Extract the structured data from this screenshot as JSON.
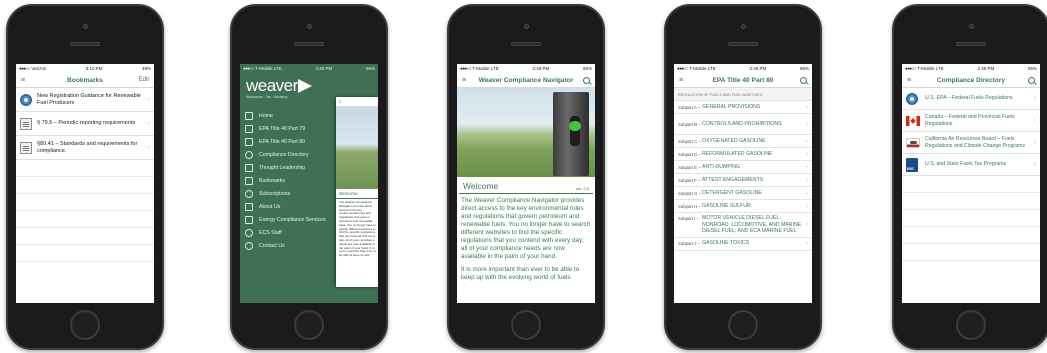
{
  "colors": {
    "accent": "#3c7a55",
    "menu_bg": "#3f6f55",
    "chevron": "#bdbdbd"
  },
  "phone1": {
    "status": {
      "carrier": "Verizon",
      "time": "3:10 PM",
      "battery": "49%"
    },
    "title": "Bookmarks",
    "edit_label": "Edit",
    "items": [
      {
        "icon": "epa-seal-icon",
        "text": "New Registration Guidance for Renewable Fuel Producers"
      },
      {
        "icon": "document-icon",
        "text": "§ 79.5 – Periodic reporting requirements"
      },
      {
        "icon": "document-icon",
        "text": "§80.41 – Standards and requirements for compliance."
      }
    ]
  },
  "phone2": {
    "status": {
      "carrier": "T-Mobile",
      "network": "LTE",
      "time": "2:46 PM",
      "battery": "66%"
    },
    "logo": {
      "word": "weaver",
      "tagline": "Assurance · Tax · Advisory"
    },
    "menu": [
      {
        "icon": "home-icon",
        "label": "Home"
      },
      {
        "icon": "book-icon",
        "label": "EPA Title 40 Part 79"
      },
      {
        "icon": "book-icon",
        "label": "EPA Title 40 Part 80"
      },
      {
        "icon": "link-icon",
        "label": "Compliance Directory"
      },
      {
        "icon": "document-icon",
        "label": "Thought Leadership"
      },
      {
        "icon": "bookmark-icon",
        "label": "Bookmarks"
      },
      {
        "icon": "rss-icon",
        "label": "Subscriptions"
      },
      {
        "icon": "arrow-icon",
        "label": "About Us"
      },
      {
        "icon": "building-icon",
        "label": "Energy Compliance Services"
      },
      {
        "icon": "people-icon",
        "label": "ECS Staff"
      },
      {
        "icon": "phone-icon",
        "label": "Contact Us"
      }
    ],
    "peek": {
      "title": "Welcome",
      "text": "The Weaver Compliance Navigator provides direct access to the key environmental rules and regulations that govern petroleum and renewable fuels. You no longer have to search different websites to find the specific regulations that you contend with every day; all of your compliance needs are now available in the palm of your hand. It is more important than ever to be able to keep up with"
    }
  },
  "phone3": {
    "status": {
      "carrier": "T-Mobile",
      "network": "LTE",
      "time": "2:48 PM",
      "battery": "66%"
    },
    "title": "Weaver Compliance Navigator",
    "welcome_title": "Welcome",
    "version": "ver. 2.0",
    "paragraph1": "The Weaver Compliance Navigator provides direct access to the key environmental rules and regulations that govern petroleum and renewable fuels. You no longer have to search different websites to find the specific regulations that you contend with every day; all of your compliance needs are now available in the palm of your hand.",
    "paragraph2": "It is more important than ever to be able to keep up with the evolving world of fuels"
  },
  "phone4": {
    "status": {
      "carrier": "T-Mobile",
      "network": "LTE",
      "time": "2:46 PM",
      "battery": "66%"
    },
    "title": "EPA Title 40 Part 80",
    "section_header": "REGULATION OF FUELS AND FUEL ADDITIVES",
    "subparts": [
      {
        "code": "Subpart A –",
        "title": "GENERAL PROVISIONS"
      },
      {
        "code": "Subpart B –",
        "title": "CONTROLS AND PROHIBITIONS"
      },
      {
        "code": "Subpart C –",
        "title": "OXYGENATED GASOLINE"
      },
      {
        "code": "Subpart D –",
        "title": "REFORMULATED GASOLINE"
      },
      {
        "code": "Subpart E –",
        "title": "ANTI-DUMPING"
      },
      {
        "code": "Subpart F –",
        "title": "ATTEST ENGAGEMENTS"
      },
      {
        "code": "Subpart G –",
        "title": "DETERGENT GASOLINE"
      },
      {
        "code": "Subpart H –",
        "title": "GASOLINE SULFUR"
      },
      {
        "code": "Subpart I –",
        "title": "MOTOR VEHICLE DIESEL FUEL; NONROAD, LOCOMOTIVE, AND MARINE DIESEL FUEL; AND ECA MARINE FUEL"
      },
      {
        "code": "Subpart J –",
        "title": "GASOLINE TOXICS"
      }
    ]
  },
  "phone5": {
    "status": {
      "carrier": "T-Mobile",
      "network": "LTE",
      "time": "2:46 PM",
      "battery": "65%"
    },
    "title": "Compliance Directory",
    "items": [
      {
        "icon": "epa-seal-icon",
        "text": "U.S. EPA – Federal Fuels Regulations"
      },
      {
        "icon": "canada-flag-icon",
        "text": "Canada – Federal and Provincial Fuels Regulations"
      },
      {
        "icon": "california-flag-icon",
        "text": "California Air Resources Board – Fuels Regulations and Climate Change Programs"
      },
      {
        "icon": "irs-logo-icon",
        "text": "U.S. and State Fuels Tax Programs"
      }
    ]
  }
}
